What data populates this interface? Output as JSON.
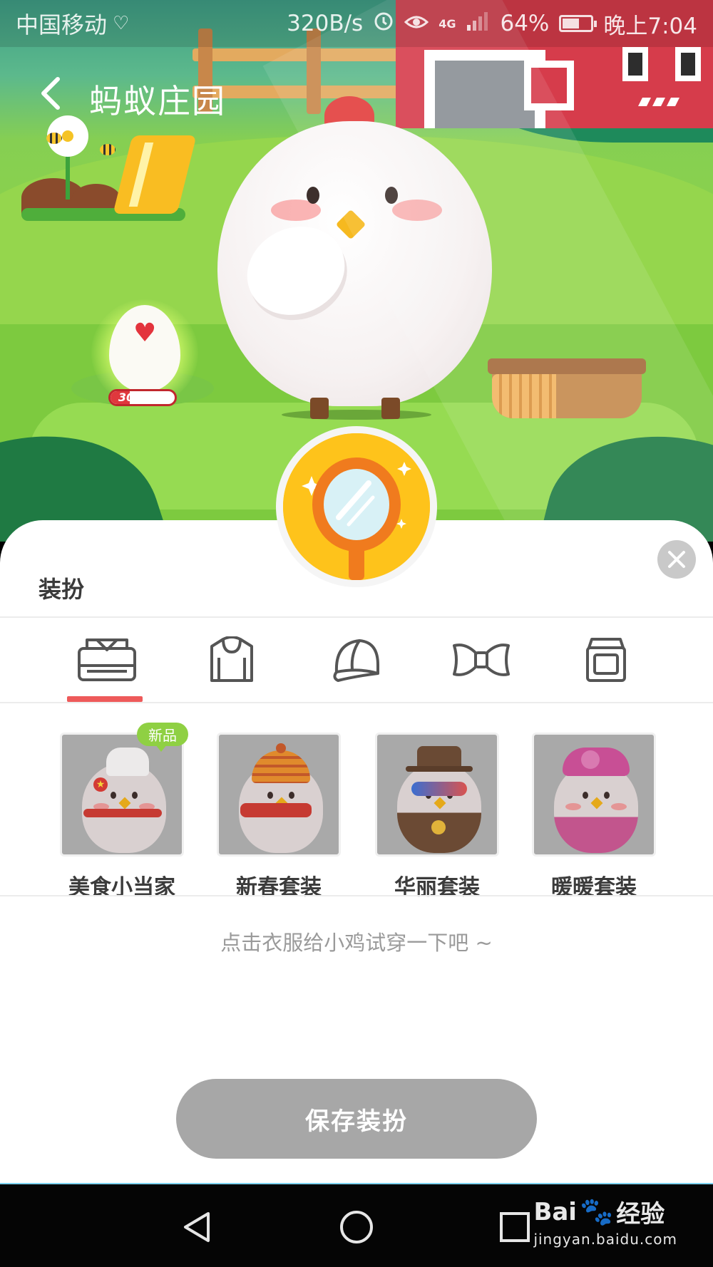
{
  "status_bar": {
    "carrier": "中国移动",
    "net_speed": "320B/s",
    "network": "4G",
    "battery": "64%",
    "battery_level": 0.64,
    "time": "晚上7:04"
  },
  "header": {
    "title": "蚂蚁庄园"
  },
  "scene": {
    "egg_progress_label": "30%",
    "egg_progress": 0.3
  },
  "sheet": {
    "title": "装扮",
    "tabs": [
      {
        "icon": "shirt-icon",
        "active": true
      },
      {
        "icon": "hoodie-icon",
        "active": false
      },
      {
        "icon": "cap-icon",
        "active": false
      },
      {
        "icon": "bowtie-icon",
        "active": false
      },
      {
        "icon": "bag-icon",
        "active": false
      }
    ],
    "outfits": [
      {
        "name": "美食小当家",
        "badge": "新品"
      },
      {
        "name": "新春套装"
      },
      {
        "name": "华丽套装"
      },
      {
        "name": "暖暖套装"
      }
    ],
    "hint": "点击衣服给小鸡试穿一下吧 ~",
    "save_label": "保存装扮"
  },
  "watermark": {
    "brand": "Bai",
    "brand_cn": "经验",
    "url": "jingyan.baidu.com"
  },
  "colors": {
    "tab_indicator": "#ee5a5a",
    "new_badge": "#8fd043",
    "save_button": "#a7a7a7",
    "mirror_badge": "#fec31b"
  }
}
